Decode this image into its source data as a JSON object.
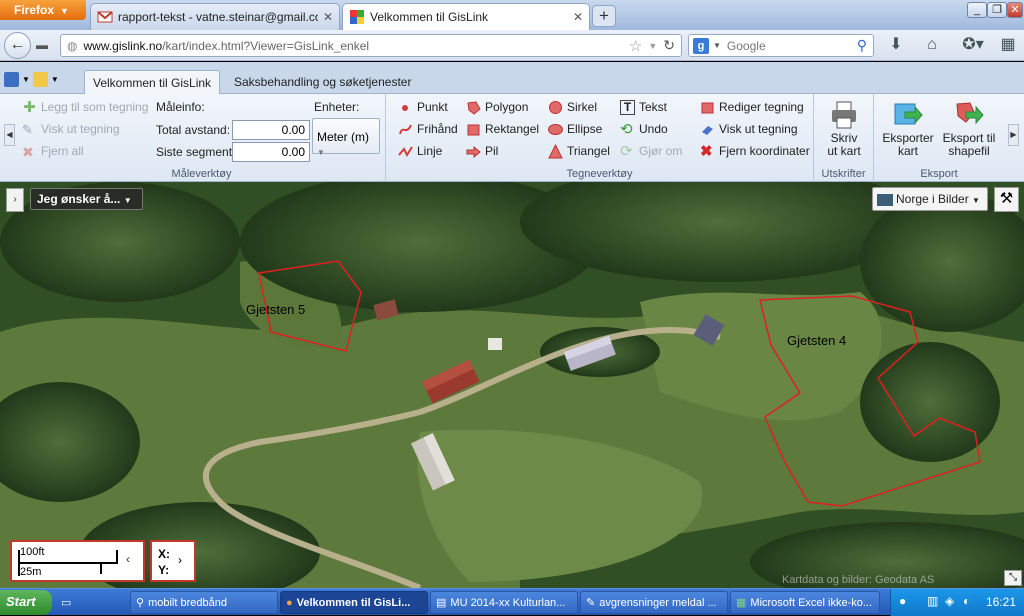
{
  "browser": {
    "menu_button": "Firefox",
    "tabs": [
      {
        "label": "rapport-tekst - vatne.steinar@gmail.com...",
        "icon": "gmail-icon"
      },
      {
        "label": "Velkommen til GisLink",
        "icon": "gislink-icon"
      }
    ],
    "url_host": "www.gislink.no",
    "url_path": "/kart/index.html?Viewer=GisLink_enkel",
    "search_placeholder": "Google"
  },
  "app": {
    "ribbon_tabs": [
      "Velkommen til GisLink",
      "Saksbehandling og søketjenester"
    ],
    "measure_group": {
      "title": "Måleverktøy",
      "add_to_drawing": "Legg til som tegning",
      "show_drawing": "Visk ut tegning",
      "remove_all": "Fjern all",
      "measure_info": "Måleinfo:",
      "units_label": "Enheter:",
      "total_label": "Total avstand:",
      "total_value": "0.00",
      "segment_label": "Siste segment:",
      "segment_value": "0.00",
      "unit_value": "Meter (m)"
    },
    "draw_group": {
      "title": "Tegneverktøy",
      "point": "Punkt",
      "freehand": "Frihånd",
      "line": "Linje",
      "polygon": "Polygon",
      "rectangle": "Rektangel",
      "arrow": "Pil",
      "circle": "Sirkel",
      "ellipse": "Ellipse",
      "triangle": "Triangel",
      "text": "Tekst",
      "undo": "Undo",
      "redo": "Gjør om",
      "edit_drawing": "Rediger tegning",
      "erase_drawing": "Visk ut tegning",
      "remove_coords": "Fjern koordinater"
    },
    "print_group": {
      "title": "Utskrifter",
      "print_line1": "Skriv",
      "print_line2": "ut kart"
    },
    "export_group": {
      "title": "Eksport",
      "export_map_line1": "Eksporter",
      "export_map_line2": "kart",
      "export_shape_line1": "Eksport til",
      "export_shape_line2": "shapefil"
    }
  },
  "map": {
    "menu_button": "Jeg ønsker å...",
    "basemap": "Norge i Bilder",
    "label1": "Gjetsten 5",
    "label2": "Gjetsten 4",
    "scale_ft": "100ft",
    "scale_m": "25m",
    "coord_x": "X:",
    "coord_y": "Y:",
    "credit": "Kartdata og bilder: Geodata AS"
  },
  "taskbar": {
    "start": "Start",
    "items": [
      "mobilt bredbånd",
      "Velkommen til GisLi...",
      "MU 2014-xx Kulturlan...",
      "avgrensninger meldal ...",
      "Microsoft Excel ikke-ko..."
    ],
    "clock": "16:21"
  },
  "colors": {
    "accent": "#c0392b",
    "ribbon": "#dde7f3",
    "taskbar": "#2458b5"
  }
}
